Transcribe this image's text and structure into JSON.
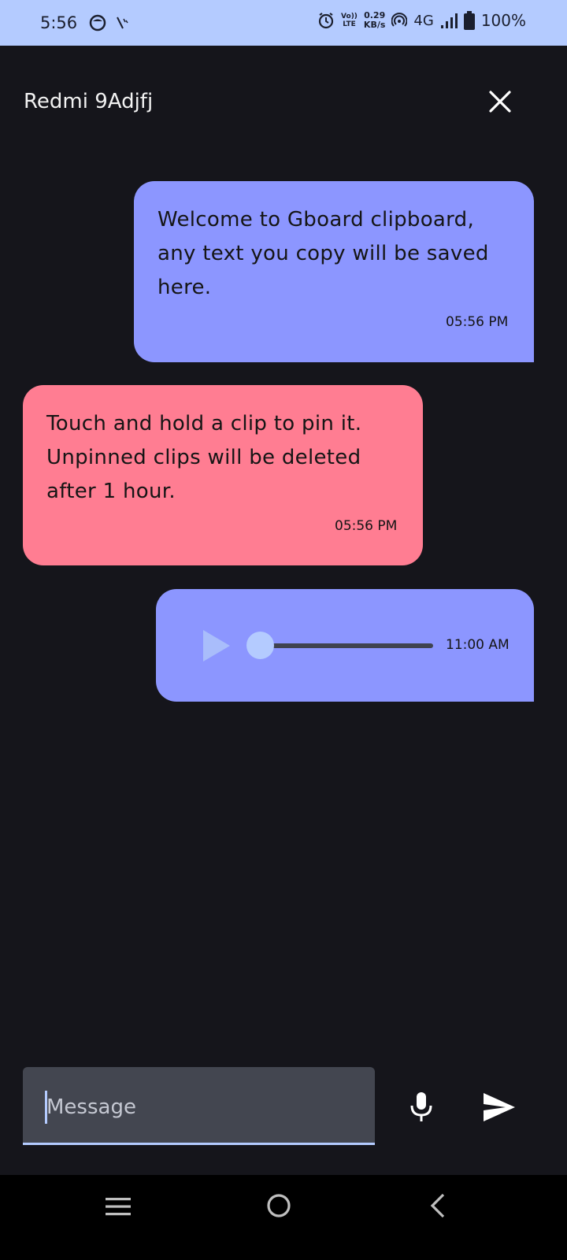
{
  "status_bar": {
    "time": "5:56",
    "volte_top": "Vo))",
    "volte_bottom": "LTE",
    "net_speed_value": "0.29",
    "net_speed_unit": "KB/s",
    "network": "4G",
    "battery": "100%",
    "icons": [
      "ghost-icon",
      "signal-slash-icon",
      "alarm-icon",
      "hotspot-icon",
      "signal-bars-icon",
      "battery-icon"
    ]
  },
  "header": {
    "contact_name": "Redmi 9Adjfj",
    "close_icon": "close-icon"
  },
  "messages": [
    {
      "direction": "outgoing",
      "lines": [
        "Welcome to Gboard clipboard,",
        "any text you copy will be saved",
        "here."
      ],
      "time": "05:56 PM",
      "color": "#8c96ff"
    },
    {
      "direction": "incoming",
      "lines": [
        "Touch and hold a clip to pin it.",
        "Unpinned clips will be deleted",
        "after 1 hour."
      ],
      "time": "05:56 PM",
      "color": "#ff7d92"
    },
    {
      "direction": "outgoing",
      "type": "audio",
      "time": "11:00 AM",
      "progress": 0,
      "color": "#8c96ff"
    }
  ],
  "composer": {
    "placeholder": "Message",
    "value": "",
    "mic_icon": "mic-icon",
    "send_icon": "send-icon"
  },
  "nav": {
    "icons": [
      "menu-icon",
      "home-icon",
      "back-icon"
    ]
  },
  "colors": {
    "accent": "#b4cbff",
    "background": "#15151b"
  }
}
